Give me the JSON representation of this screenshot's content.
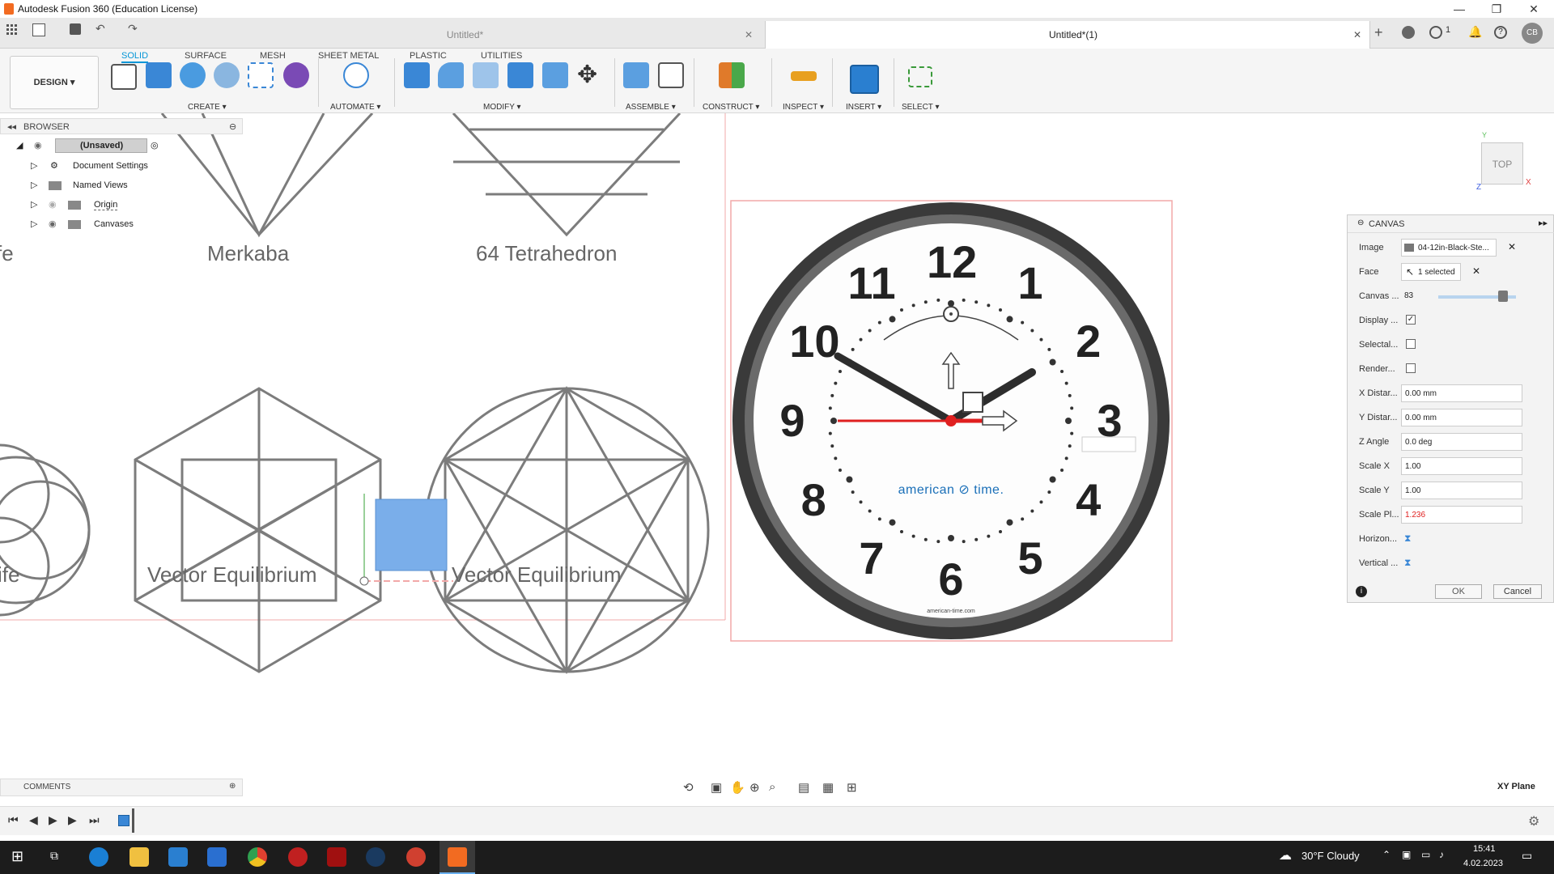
{
  "app": {
    "title": "Autodesk Fusion 360 (Education License)"
  },
  "window_controls": {
    "minimize": "—",
    "maximize": "❐",
    "close": "✕"
  },
  "header_right": {
    "jobs_count": "1",
    "user_initials": "CB"
  },
  "tabs": [
    {
      "label": "Untitled*",
      "active": false
    },
    {
      "label": "Untitled*(1)",
      "active": true
    }
  ],
  "ribbon": {
    "workspace": "DESIGN",
    "tabs": [
      "SOLID",
      "SURFACE",
      "MESH",
      "SHEET METAL",
      "PLASTIC",
      "UTILITIES"
    ],
    "active_tab": "SOLID",
    "groups": [
      "CREATE",
      "AUTOMATE",
      "MODIFY",
      "ASSEMBLE",
      "CONSTRUCT",
      "INSPECT",
      "INSERT",
      "SELECT"
    ]
  },
  "browser": {
    "title": "BROWSER",
    "root": "(Unsaved)",
    "items": [
      "Document Settings",
      "Named Views",
      "Origin",
      "Canvases"
    ]
  },
  "viewport": {
    "labels": [
      "Merkaba",
      "64 Tetrahedron",
      "Vector Equilibrium",
      "Vector Equilibrium",
      "fe",
      "ife"
    ],
    "clock_numbers": [
      "12",
      "1",
      "2",
      "3",
      "4",
      "5",
      "6",
      "7",
      "8",
      "9",
      "10",
      "11"
    ],
    "clock_brand": "american ⊘ time.",
    "clock_url": "american-time.com",
    "viewcube": "TOP",
    "axis_labels": [
      "Y",
      "X",
      "Z"
    ],
    "plane": "XY Plane"
  },
  "canvas_panel": {
    "title": "CANVAS",
    "rows": [
      {
        "label": "Image",
        "value": "04-12in-Black-Ste...",
        "kind": "file"
      },
      {
        "label": "Face",
        "value": "1 selected",
        "kind": "select"
      },
      {
        "label": "Canvas ...",
        "value": "83",
        "kind": "slider",
        "level": 0.83
      },
      {
        "label": "Display ...",
        "value": "",
        "kind": "check",
        "checked": true
      },
      {
        "label": "Selectal...",
        "value": "",
        "kind": "check",
        "checked": false
      },
      {
        "label": "Render...",
        "value": "",
        "kind": "check",
        "checked": false
      },
      {
        "label": "X Distar...",
        "value": "0.00 mm",
        "kind": "field"
      },
      {
        "label": "Y Distar...",
        "value": "0.00 mm",
        "kind": "field"
      },
      {
        "label": "Z Angle",
        "value": "0.0 deg",
        "kind": "field"
      },
      {
        "label": "Scale X",
        "value": "1.00",
        "kind": "field"
      },
      {
        "label": "Scale Y",
        "value": "1.00",
        "kind": "field"
      },
      {
        "label": "Scale Pl...",
        "value": "1.236",
        "kind": "field-red"
      },
      {
        "label": "Horizon...",
        "value": "",
        "kind": "icon"
      },
      {
        "label": "Vertical ...",
        "value": "",
        "kind": "icon"
      }
    ],
    "ok": "OK",
    "cancel": "Cancel"
  },
  "comments": {
    "label": "COMMENTS"
  },
  "taskbar": {
    "weather": "30°F  Cloudy",
    "time": "15:41",
    "date": "4.02.2023"
  },
  "colors": {
    "accent": "#0696d7",
    "red": "#e02020",
    "taskbar": "#1c1c1c",
    "selection_blue": "#7aaeea"
  }
}
